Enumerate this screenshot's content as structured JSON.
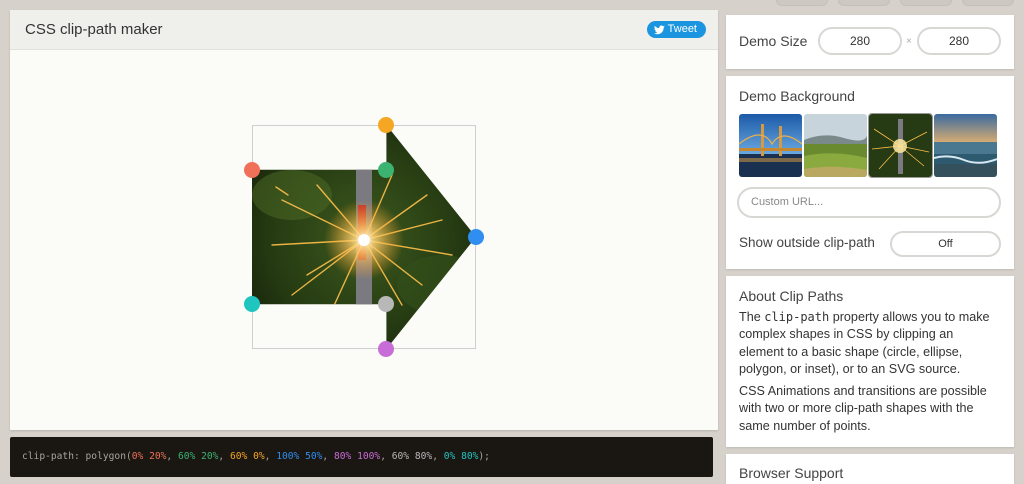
{
  "app": {
    "title": "CSS clip-path maker",
    "tweet_label": "Tweet"
  },
  "demo_size": {
    "label": "Demo Size",
    "width": "280",
    "separator": "×",
    "height": "280"
  },
  "demo_background": {
    "label": "Demo Background",
    "thumbnails": [
      "bridge-night",
      "green-field",
      "sparkler",
      "seashore"
    ],
    "selected": "sparkler",
    "custom_url_placeholder": "Custom URL...",
    "show_outside_label": "Show outside clip-path",
    "show_outside_value": "Off"
  },
  "about": {
    "title": "About Clip Paths",
    "p1_pre": "The ",
    "p1_code": "clip-path",
    "p1_post": " property allows you to make complex shapes in CSS by clipping an element to a basic shape (circle, ellipse, polygon, or inset), or to an SVG source.",
    "p2": "CSS Animations and transitions are possible with two or more clip-path shapes with the same number of points."
  },
  "browser_support": {
    "title": "Browser Support"
  },
  "code": {
    "prefix": "clip-path: polygon(",
    "points": [
      {
        "text": "0% 20%",
        "color": "#f0705a"
      },
      {
        "text": "60% 20%",
        "color": "#3cb371"
      },
      {
        "text": "60% 0%",
        "color": "#f5a623"
      },
      {
        "text": "100% 50%",
        "color": "#2f8ef0"
      },
      {
        "text": "80% 100%",
        "color": "#c86dd7"
      },
      {
        "text": "60% 80%",
        "color": "#b8b8b8"
      },
      {
        "text": "0% 80%",
        "color": "#20c5c0"
      }
    ],
    "separator": ", ",
    "suffix": ");"
  },
  "colors": {
    "accent_tweet": "#1b95e0",
    "handles": [
      "#f0705a",
      "#3cb371",
      "#f5a623",
      "#2f8ef0",
      "#c86dd7",
      "#b8b8b8",
      "#20c5c0"
    ]
  }
}
